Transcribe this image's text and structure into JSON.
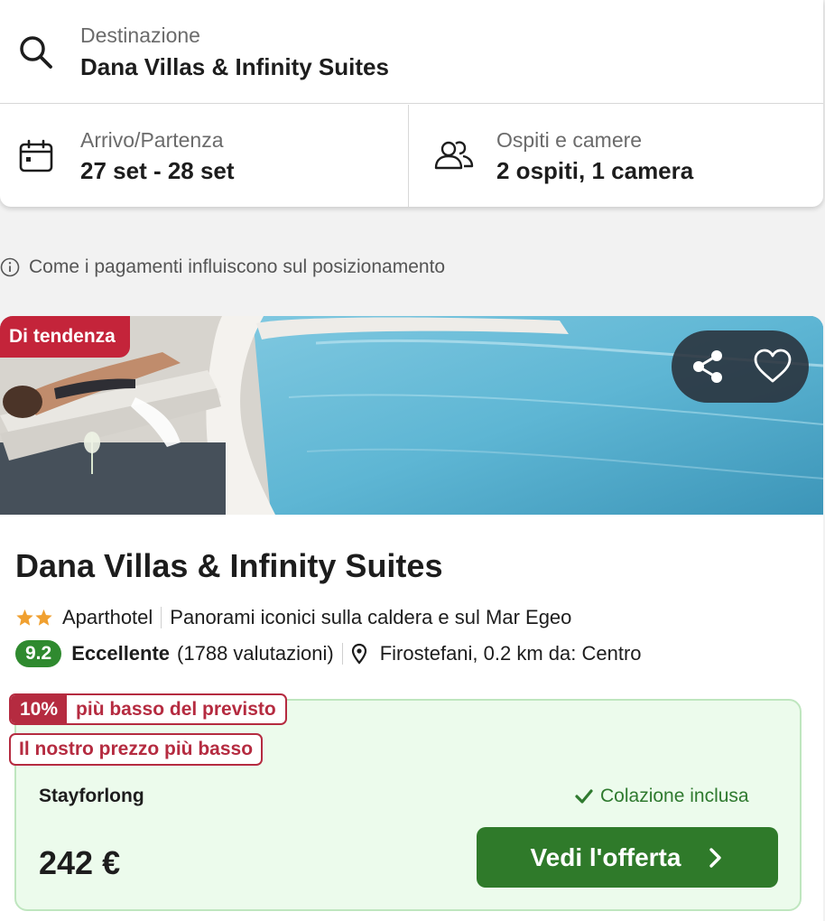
{
  "search": {
    "destination_label": "Destinazione",
    "destination_value": "Dana Villas & Infinity Suites",
    "dates_label": "Arrivo/Partenza",
    "dates_value": "27 set - 28 set",
    "guests_label": "Ospiti e camere",
    "guests_value": "2 ospiti, 1 camera"
  },
  "payment_note": "Come i pagamenti influiscono sul posizionamento",
  "hotel": {
    "badge": "Di tendenza",
    "name": "Dana Villas & Infinity Suites",
    "star_count": 2,
    "type": "Aparthotel",
    "highlight": "Panorami iconici sulla caldera e sul Mar Egeo",
    "score": "9.2",
    "rating_word": "Eccellente",
    "reviews": "(1788 valutazioni)",
    "location": "Firostefani, 0.2 km da: Centro"
  },
  "offer": {
    "discount_pct": "10%",
    "discount_text": "più basso del previsto",
    "lowest_badge": "Il nostro prezzo più basso",
    "provider": "Stayforlong",
    "breakfast": "Colazione inclusa",
    "price": "242 €",
    "cta": "Vedi l'offerta"
  },
  "colors": {
    "badge_red": "#c4243a",
    "score_green": "#2f8a2f",
    "cta_green": "#2f7a2a",
    "offer_bg": "#ecfbec",
    "star_orange": "#f0a030"
  },
  "icons": [
    "search-icon",
    "calendar-icon",
    "users-icon",
    "info-icon",
    "share-icon",
    "heart-icon",
    "star-icon",
    "location-pin-icon",
    "check-icon",
    "chevron-right-icon"
  ]
}
